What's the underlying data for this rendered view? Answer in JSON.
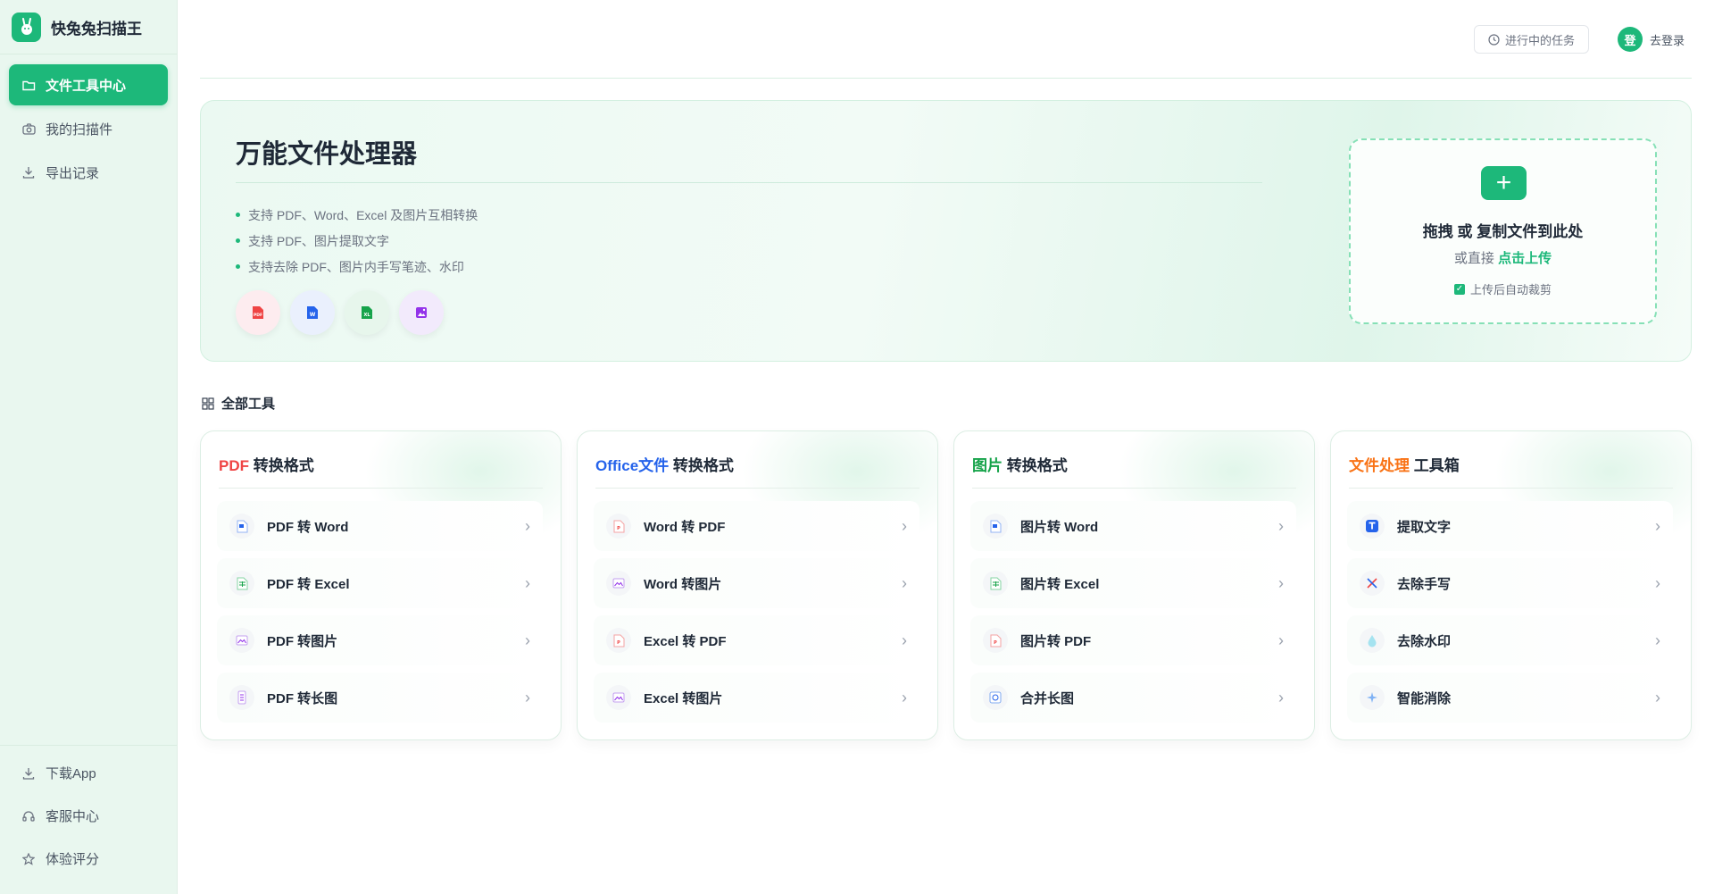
{
  "app": {
    "name": "快兔兔扫描王",
    "logo_glyph": "🐰"
  },
  "sidebar": {
    "items": [
      {
        "label": "文件工具中心",
        "icon": "folder-icon",
        "active": true
      },
      {
        "label": "我的扫描件",
        "icon": "camera-icon",
        "active": false
      },
      {
        "label": "导出记录",
        "icon": "download-icon",
        "active": false
      }
    ],
    "bottom": [
      {
        "label": "下载App",
        "icon": "download-icon"
      },
      {
        "label": "客服中心",
        "icon": "headset-icon"
      },
      {
        "label": "体验评分",
        "icon": "star-icon"
      }
    ]
  },
  "topbar": {
    "tasks_label": "进行中的任务",
    "avatar_text": "登",
    "login_label": "去登录"
  },
  "hero": {
    "title": "万能文件处理器",
    "features": [
      "支持 PDF、Word、Excel 及图片互相转换",
      "支持 PDF、图片提取文字",
      "支持去除 PDF、图片内手写笔迹、水印"
    ],
    "format_icons": [
      "pdf-icon",
      "word-icon",
      "excel-icon",
      "image-icon"
    ]
  },
  "upload": {
    "main": "拖拽 或 复制文件到此处",
    "sub_prefix": "或直接",
    "sub_link": "点击上传",
    "checkbox_label": "上传后自动裁剪",
    "checked": true
  },
  "section": {
    "title": "全部工具"
  },
  "cards": [
    {
      "highlight": "PDF",
      "highlight_color": "#ef4444",
      "title_rest": " 转换格式",
      "items": [
        {
          "label": "PDF 转 Word",
          "icon": "word-doc-icon"
        },
        {
          "label": "PDF 转 Excel",
          "icon": "excel-doc-icon"
        },
        {
          "label": "PDF 转图片",
          "icon": "image-doc-icon"
        },
        {
          "label": "PDF 转长图",
          "icon": "long-image-icon"
        }
      ]
    },
    {
      "highlight": "Office文件",
      "highlight_color": "#2563eb",
      "title_rest": " 转换格式",
      "items": [
        {
          "label": "Word 转 PDF",
          "icon": "pdf-doc-icon"
        },
        {
          "label": "Word 转图片",
          "icon": "image-doc-icon"
        },
        {
          "label": "Excel 转 PDF",
          "icon": "pdf-doc-icon"
        },
        {
          "label": "Excel 转图片",
          "icon": "image-doc-icon"
        }
      ]
    },
    {
      "highlight": "图片",
      "highlight_color": "#16a34a",
      "title_rest": " 转换格式",
      "items": [
        {
          "label": "图片转 Word",
          "icon": "word-doc-icon"
        },
        {
          "label": "图片转 Excel",
          "icon": "excel-doc-icon"
        },
        {
          "label": "图片转 PDF",
          "icon": "pdf-doc-icon"
        },
        {
          "label": "合并长图",
          "icon": "merge-image-icon"
        }
      ]
    },
    {
      "highlight": "文件处理",
      "highlight_color": "#f97316",
      "title_rest": " 工具箱",
      "items": [
        {
          "label": "提取文字",
          "icon": "text-extract-icon"
        },
        {
          "label": "去除手写",
          "icon": "eraser-icon"
        },
        {
          "label": "去除水印",
          "icon": "watermark-icon"
        },
        {
          "label": "智能消除",
          "icon": "sparkle-icon"
        }
      ]
    }
  ],
  "colors": {
    "brand": "#1db87a",
    "pdf": "#ef4444",
    "word": "#2563eb",
    "excel": "#16a34a",
    "image": "#9333ea",
    "tool": "#f97316"
  }
}
